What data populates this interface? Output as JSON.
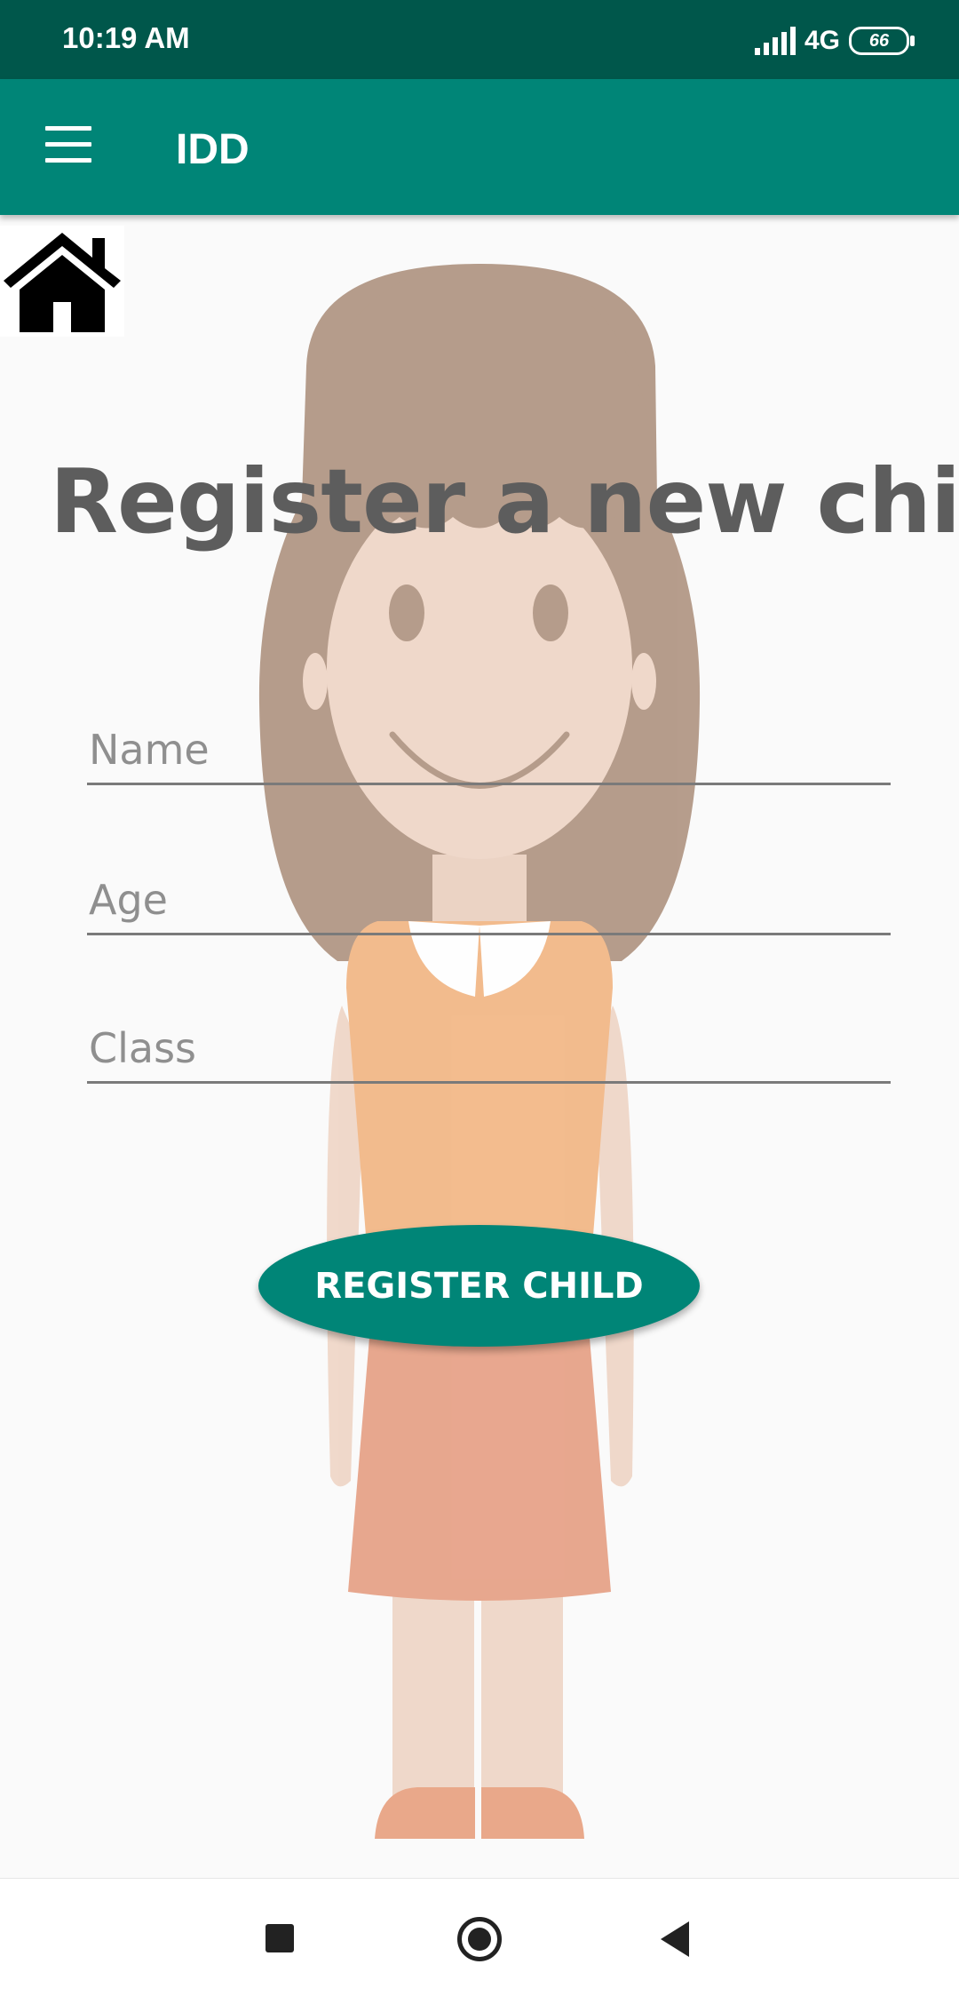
{
  "status_bar": {
    "time": "10:19 AM",
    "network": "4G",
    "battery": "66"
  },
  "app_bar": {
    "title": "IDD",
    "menu_icon": "hamburger-menu-icon"
  },
  "home_icon": "home-icon",
  "page": {
    "title": "Register a new child"
  },
  "form": {
    "name_placeholder": "Name",
    "age_placeholder": "Age",
    "class_placeholder": "Class",
    "submit_label": "REGISTER CHILD"
  },
  "nav_bar": {
    "recents_icon": "square-recents-icon",
    "home_icon": "circle-home-icon",
    "back_icon": "triangle-back-icon"
  },
  "colors": {
    "status_bar": "#00574b",
    "primary": "#008577",
    "title_text": "#5d5d5d"
  }
}
